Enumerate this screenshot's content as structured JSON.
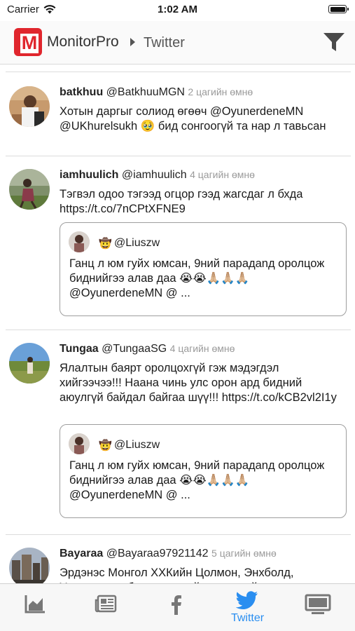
{
  "status_bar": {
    "carrier": "Carrier",
    "time": "1:02 AM"
  },
  "nav": {
    "app_name": "MonitorPro",
    "current": "Twitter",
    "logo_icon": "monitorpro-logo",
    "filter_icon": "filter-icon"
  },
  "posts": [
    {
      "name": "batkhuu",
      "handle": "@BatkhuuMGN",
      "time": "2 цагийн өмнө",
      "text": "Хотын даргыг солиод өгөөч @OyunerdeneMN @UKhurelsukh 🥹 бид сонгоогүй та нар л тавьсан"
    },
    {
      "name": "iamhuulich",
      "handle": "@iamhuulich",
      "time": "4 цагийн өмнө",
      "text": "Тэгвэл одоо тэгээд огцор гээд жагсдаг л бхда https://t.co/7nCPtXFNE9",
      "quote": {
        "badge": "🤠",
        "handle": "@Liuszw",
        "text": "Ганц л юм гуйх юмсан, 9ний парадanд оролцож биднийгээ алав даа 😭😭🙏🏼🙏🏼🙏🏼 @OyunerdeneMN @ ..."
      }
    },
    {
      "name": "Tungaa",
      "handle": "@TungaaSG",
      "time": "4 цагийн өмнө",
      "text": "Ялалтын баярт оролцохгүй гэж мэдэгдэл хийгээчээ!!! Наана чинь улс орон ард бидний аюулгүй байдал байгаа шүү!!! https://t.co/kCB2vl2I1y",
      "quote": {
        "badge": "🤠",
        "handle": "@Liuszw",
        "text": "Ганц л юм гуйх юмсан, 9ний парадanд оролцож биднийгээ алав даа 😭😭🙏🏼🙏🏼🙏🏼 @OyunerdeneMN @ ..."
      }
    },
    {
      "name": "Bayaraa",
      "handle": "@Bayaraa97921142",
      "time": "5 цагийн өмнө",
      "text": "Эрдэнэс Монгол ХХКийн Цолмон, Энхболд, Удирдлагын бүх гишүүдийг яаралтай"
    }
  ],
  "tabs": [
    {
      "icon": "chart-icon",
      "label": ""
    },
    {
      "icon": "news-icon",
      "label": ""
    },
    {
      "icon": "facebook-icon",
      "label": ""
    },
    {
      "icon": "twitter-icon",
      "label": "Twitter"
    },
    {
      "icon": "tv-icon",
      "label": ""
    }
  ],
  "colors": {
    "accent": "#2a8ef0",
    "brand": "#e0262d"
  }
}
